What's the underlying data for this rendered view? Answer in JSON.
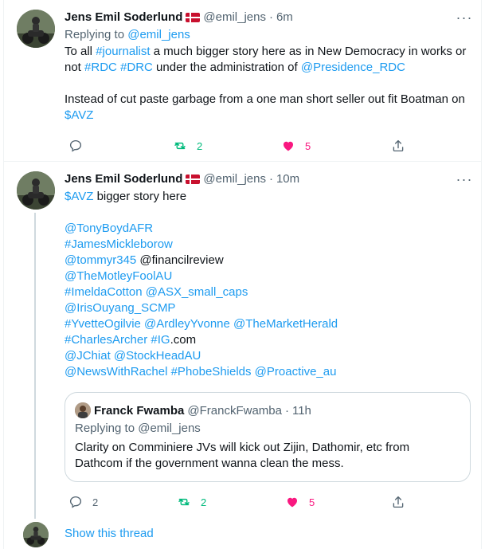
{
  "tweet1": {
    "author_name": "Jens Emil Soderlund",
    "handle": "@emil_jens",
    "separator": "·",
    "time": "6m",
    "replying_prefix": "Replying to",
    "replying_handle": "@emil_jens",
    "line1_a": "To all ",
    "line1_hashtag": "#journalist",
    "line1_b": " a much bigger story here as in New Democracy in works or",
    "line2_a": "not ",
    "line2_tag1": "#RDC",
    "line2_space": " ",
    "line2_tag2": "#DRC",
    "line2_b": " under the administration of ",
    "line2_mention": "@Presidence_RDC",
    "line3": "Instead of cut paste garbage from a one man short seller out fit Boatman on",
    "line4_cashtag": "$AVZ",
    "retweets": "2",
    "likes": "5",
    "more_icon": "more-icon"
  },
  "tweet2": {
    "author_name": "Jens Emil Soderlund",
    "handle": "@emil_jens",
    "separator": "·",
    "time": "10m",
    "cashtag": "$AVZ",
    "intro": " bigger story here",
    "lines": {
      "l1": "@TonyBoydAFR",
      "l2": "#JamesMickleborow",
      "l3a": "@tommyr345",
      "l3b": " @financilreview",
      "l4": "@TheMotleyFoolAU",
      "l5": "#ImeldaCotton @ASX_small_caps",
      "l6": "@IrisOuyang_SCMP",
      "l7": "#YvetteOgilvie @ArdleyYvonne @TheMarketHerald",
      "l8a": "#CharlesArcher #IG",
      "l8b": ".com",
      "l9": "@JChiat @StockHeadAU",
      "l10": "@NewsWithRachel #PhobeShields @Proactive_au"
    },
    "replies": "2",
    "retweets": "2",
    "likes": "5"
  },
  "quote": {
    "author_name": "Franck Fwamba",
    "handle": "@FranckFwamba",
    "separator": "·",
    "time": "11h",
    "replying_prefix": "Replying to",
    "replying_handle": "@emil_jens",
    "text_line1": "Clarity on Comminiere JVs will kick out Zijin, Dathomir, etc from",
    "text_line2": "Dathcom if the government wanna clean the mess."
  },
  "show_thread": "Show this thread",
  "colors": {
    "link": "#1d9bf0",
    "retweet": "#00ba7c",
    "like": "#f91880",
    "muted": "#536471",
    "border": "#cfd9de"
  }
}
